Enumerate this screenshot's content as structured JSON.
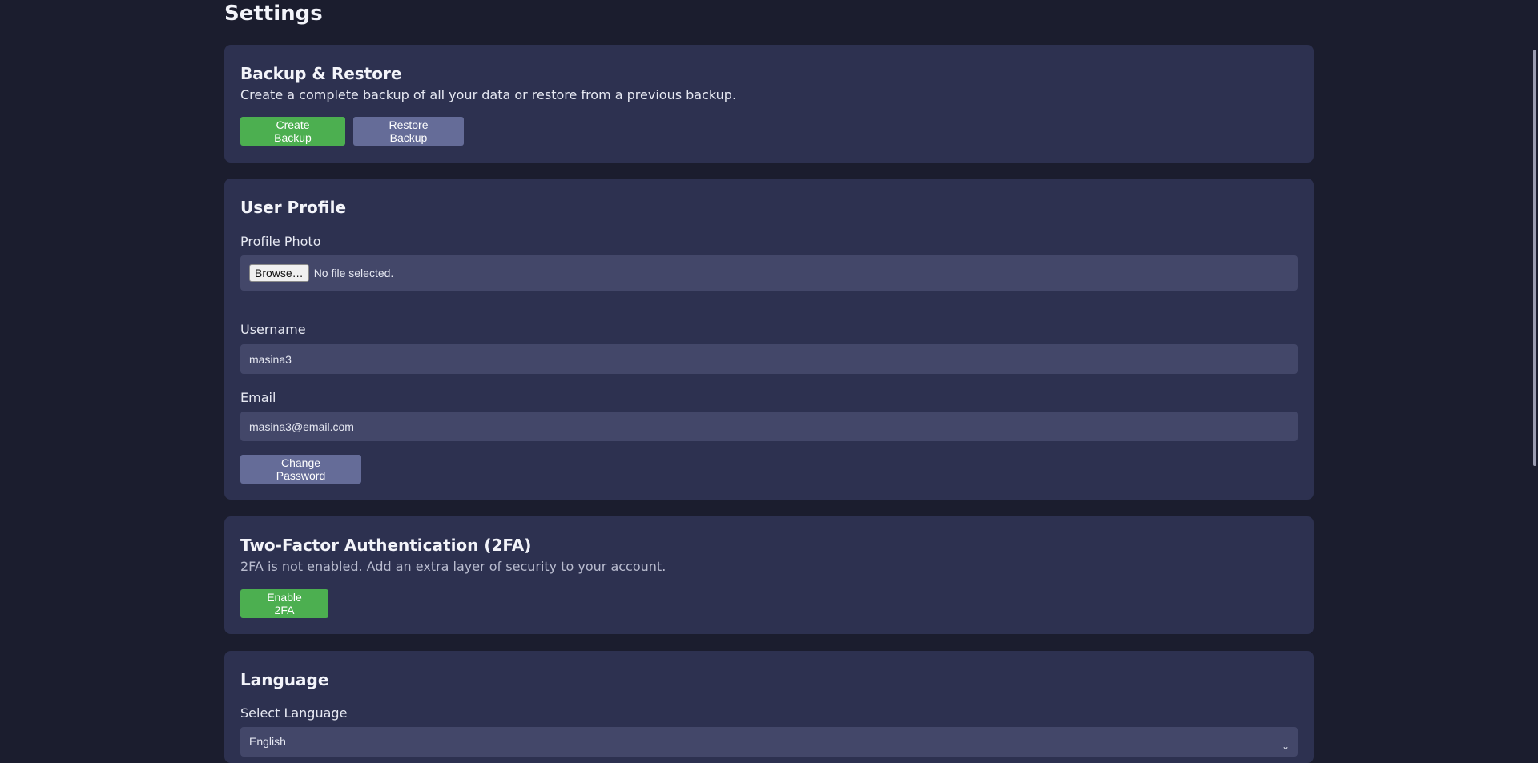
{
  "page": {
    "title": "Settings"
  },
  "backup": {
    "title": "Backup & Restore",
    "description": "Create a complete backup of all your data or restore from a previous backup.",
    "create_label": "Create Backup",
    "restore_label": "Restore Backup"
  },
  "profile": {
    "title": "User Profile",
    "photo_label": "Profile Photo",
    "browse_label": "Browse…",
    "file_status": "No file selected.",
    "username_label": "Username",
    "username_value": "masina3",
    "email_label": "Email",
    "email_value": "masina3@email.com",
    "change_password_label": "Change Password"
  },
  "twofa": {
    "title": "Two-Factor Authentication (2FA)",
    "description": "2FA is not enabled. Add an extra layer of security to your account.",
    "enable_label": "Enable 2FA"
  },
  "language": {
    "title": "Language",
    "select_label": "Select Language",
    "selected_value": "English",
    "arrow_icon": "chevron-down-icon"
  },
  "colors": {
    "background": "#1b1d2e",
    "card": "#2d3150",
    "input": "#434769",
    "primary_green": "#4caf50",
    "secondary_slate": "#656c98"
  }
}
